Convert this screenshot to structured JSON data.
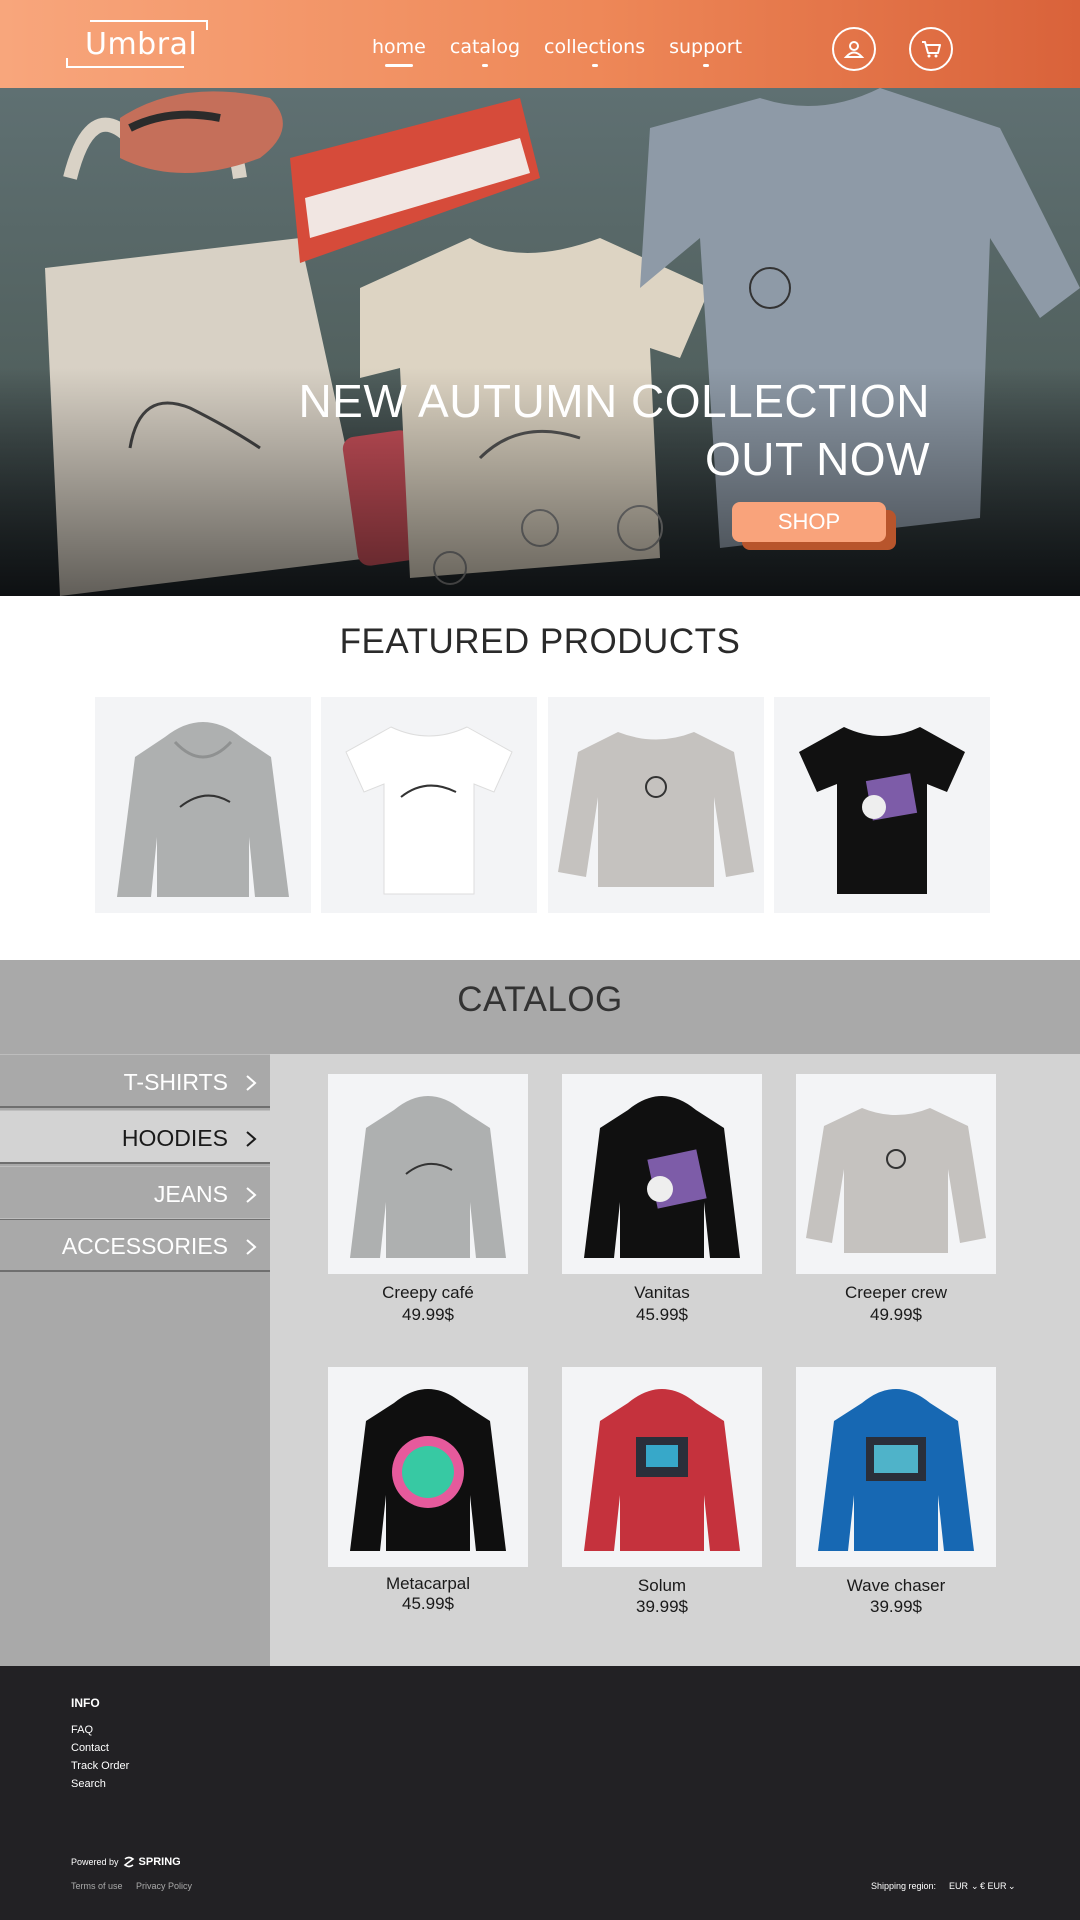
{
  "header": {
    "logo": "Umbral",
    "nav": [
      {
        "label": "home",
        "active": true
      },
      {
        "label": "catalog",
        "active": false
      },
      {
        "label": "collections",
        "active": false
      },
      {
        "label": "support",
        "active": false
      }
    ],
    "icons": [
      "user-icon",
      "cart-icon"
    ],
    "gradient_colors": [
      "#f8a67c",
      "#d9623a"
    ]
  },
  "hero": {
    "title_line1": "NEW AUTUMN COLLECTION",
    "title_line2": "OUT NOW",
    "cta": "SHOP",
    "cta_color": "#f9a37b"
  },
  "featured": {
    "title": "FEATURED PRODUCTS",
    "items": [
      {
        "image": "grey hoodie with synth skull print",
        "color": "#aeb0b0"
      },
      {
        "image": "white t-shirt with synth skull print",
        "color": "#ffffff"
      },
      {
        "image": "grey sweatshirt with headphone figure print",
        "color": "#c5c2bf"
      },
      {
        "image": "black t-shirt with skull and drum machine print",
        "color": "#111111"
      }
    ]
  },
  "catalog": {
    "title": "CATALOG",
    "categories": [
      {
        "label": "T-SHIRTS",
        "active": false
      },
      {
        "label": "HOODIES",
        "active": true
      },
      {
        "label": "JEANS",
        "active": false
      },
      {
        "label": "ACCESSORIES",
        "active": false
      }
    ],
    "products": [
      {
        "name": "Creepy café",
        "price": "49.99$",
        "color": "#aeb0b0"
      },
      {
        "name": "Vanitas",
        "price": "45.99$",
        "color": "#101010"
      },
      {
        "name": "Creeper crew",
        "price": "49.99$",
        "color": "#c5c2bf"
      },
      {
        "name": "Metacarpal",
        "price": "45.99$",
        "color": "#0f0f0f"
      },
      {
        "name": "Solum",
        "price": "39.99$",
        "color": "#c5323d"
      },
      {
        "name": "Wave chaser",
        "price": "39.99$",
        "color": "#1768b3"
      }
    ]
  },
  "footer": {
    "info_heading": "INFO",
    "links": [
      "FAQ",
      "Contact",
      "Track Order",
      "Search"
    ],
    "powered_by": "Powered by",
    "powered_brand": "SPRING",
    "terms": "Terms of use",
    "privacy": "Privacy Policy",
    "shipping_label": "Shipping region:",
    "shipping_value": "EUR",
    "currency": "€ EUR"
  }
}
